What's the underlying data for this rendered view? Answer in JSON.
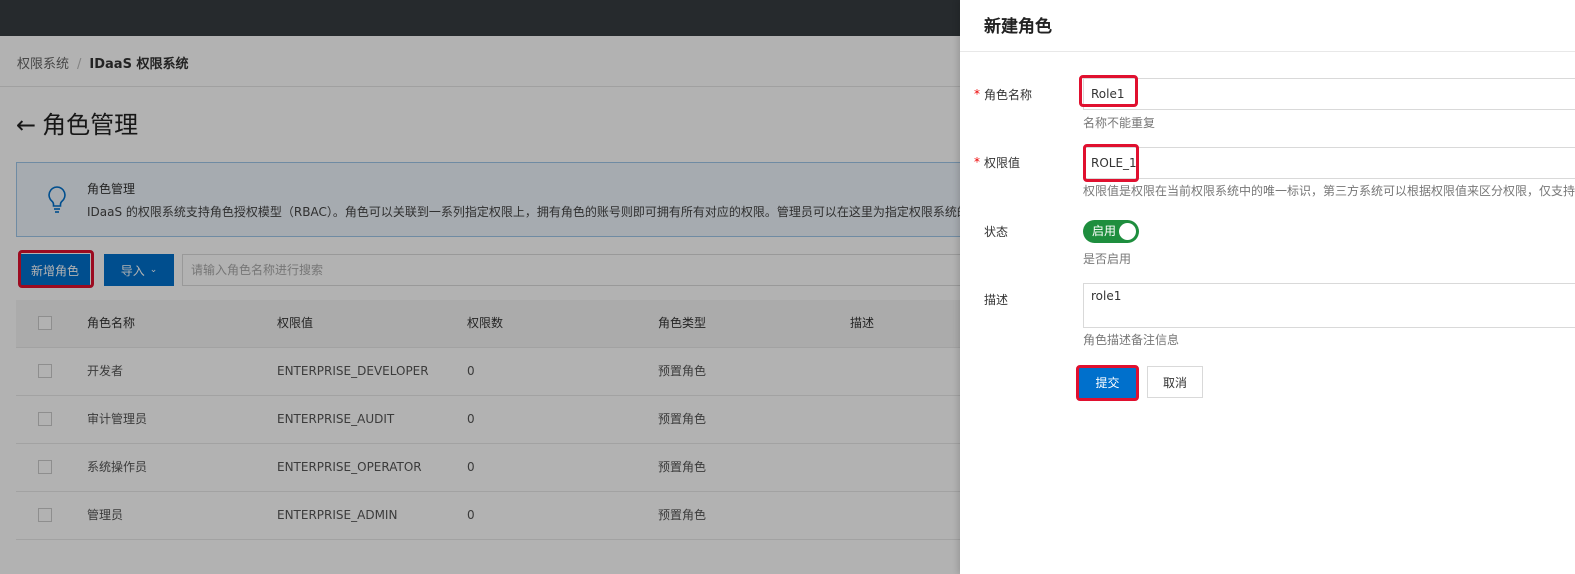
{
  "breadcrumb": {
    "root": "权限系统",
    "current": "IDaaS 权限系统"
  },
  "page": {
    "title": "角色管理"
  },
  "info": {
    "title": "角色管理",
    "text": "IDaaS 的权限系统支持角色授权模型（RBAC）。角色可以关联到一系列指定权限上，拥有角色的账号则即可拥有所有对应的权限。管理员可以在这里为指定权限系统的"
  },
  "toolbar": {
    "add_label": "新增角色",
    "import_label": "导入",
    "search_placeholder": "请输入角色名称进行搜索"
  },
  "table": {
    "headers": [
      "角色名称",
      "权限值",
      "权限数",
      "角色类型",
      "描述"
    ],
    "rows": [
      {
        "name": "开发者",
        "value": "ENTERPRISE_DEVELOPER",
        "count": "0",
        "type": "预置角色"
      },
      {
        "name": "审计管理员",
        "value": "ENTERPRISE_AUDIT",
        "count": "0",
        "type": "预置角色"
      },
      {
        "name": "系统操作员",
        "value": "ENTERPRISE_OPERATOR",
        "count": "0",
        "type": "预置角色"
      },
      {
        "name": "管理员",
        "value": "ENTERPRISE_ADMIN",
        "count": "0",
        "type": "预置角色"
      }
    ]
  },
  "drawer": {
    "title": "新建角色",
    "name_label": "角色名称",
    "name_value": "Role1",
    "name_help": "名称不能重复",
    "perm_label": "权限值",
    "perm_value": "ROLE_1",
    "perm_help": "权限值是权限在当前权限系统中的唯一标识，第三方系统可以根据权限值来区分权限，仅支持",
    "status_label": "状态",
    "status_value": "启用",
    "status_help": "是否启用",
    "desc_label": "描述",
    "desc_value": "role1",
    "desc_help": "角色描述备注信息",
    "submit_label": "提交",
    "cancel_label": "取消"
  },
  "colors": {
    "primary": "#0070cc",
    "toggle_on": "#1e8e3e",
    "highlight": "#e0102f"
  }
}
